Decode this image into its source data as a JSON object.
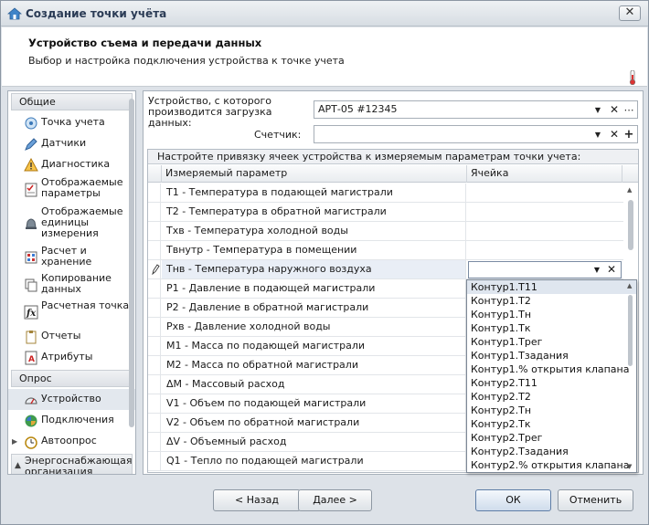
{
  "window": {
    "title": "Создание точки учёта",
    "close_label": "✕"
  },
  "header": {
    "title": "Устройство съема и передачи данных",
    "subtitle": "Выбор и настройка подключения устройства к точке учета"
  },
  "nav": {
    "groups": [
      {
        "label": "Общие",
        "items": [
          {
            "label": "Точка учета",
            "icon": "location-icon"
          },
          {
            "label": "Датчики",
            "icon": "pencil-icon"
          },
          {
            "label": "Диагностика",
            "icon": "warning-icon"
          },
          {
            "label": "Отображаемые параметры",
            "icon": "checklist-icon"
          },
          {
            "label": "Отображаемые единицы измерения",
            "icon": "bell-icon"
          },
          {
            "label": "Расчет и хранение",
            "icon": "calculator-icon"
          },
          {
            "label": "Копирование данных",
            "icon": "copy-icon"
          },
          {
            "label": "Расчетная точка",
            "icon": "function-icon"
          },
          {
            "label": "Отчеты",
            "icon": "clipboard-icon"
          },
          {
            "label": "Атрибуты",
            "icon": "attributes-icon"
          }
        ]
      },
      {
        "label": "Опрос",
        "items": [
          {
            "label": "Устройство",
            "icon": "gauge-icon",
            "selected": true
          },
          {
            "label": "Подключения",
            "icon": "connections-icon"
          },
          {
            "label": "Автоопрос",
            "icon": "clock-icon"
          }
        ]
      },
      {
        "label": "Энергоснабжающая организация",
        "items": []
      }
    ]
  },
  "device": {
    "label": "Устройство, с которого производится загрузка данных:",
    "value": "АРТ-05 #12345",
    "counter_label": "Счетчик:",
    "counter_value": ""
  },
  "grid": {
    "caption": "Настройте привязку ячеек устройства к измеряемым параметрам точки учета:",
    "col_param": "Измеряемый параметр",
    "col_cell": "Ячейка",
    "rows": [
      "T1 - Температура в подающей магистрали",
      "T2 - Температура в обратной магистрали",
      "Тхв - Температура холодной воды",
      "Твнутр - Температура в помещении",
      "Тнв - Температура наружного воздуха",
      "P1 - Давление в подающей магистрали",
      "P2 - Давление в обратной магистрали",
      "Рхв - Давление холодной воды",
      "M1 - Масса по подающей магистрали",
      "M2 - Масса по обратной магистрали",
      "ΔM - Массовый расход",
      "V1 - Объем по подающей магистрали",
      "V2 - Объем по обратной магистрали",
      "ΔV - Объемный расход",
      "Q1 - Тепло по подающей магистрали"
    ],
    "active_row": 4
  },
  "dropdown": {
    "items": [
      "Контур1.Т11",
      "Контур1.Т2",
      "Контур1.Тн",
      "Контур1.Тк",
      "Контур1.Трег",
      "Контур1.Тзадания",
      "Контур1.% открытия клапана",
      "Контур2.Т11",
      "Контур2.Т2",
      "Контур2.Тн",
      "Контур2.Тк",
      "Контур2.Трег",
      "Контур2.Тзадания",
      "Контур2.% открытия клапана"
    ],
    "highlighted": 0
  },
  "footer": {
    "back": "< Назад",
    "next": "Далее >",
    "ok": "ОК",
    "cancel": "Отменить"
  }
}
